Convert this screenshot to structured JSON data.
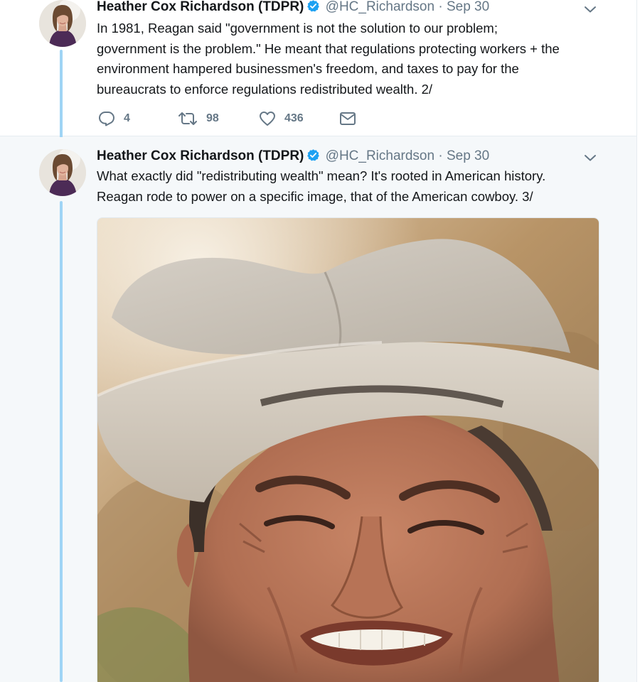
{
  "tweets": [
    {
      "author_name": "Heather Cox Richardson (TDPR)",
      "handle": "@HC_Richardson",
      "separator": "·",
      "date": "Sep 30",
      "text_lines": [
        "In 1981, Reagan said \"government is not the solution to our problem;",
        "government is the problem.\" He meant that regulations protecting workers + the",
        "environment hampered businessmen's freedom, and taxes to pay for the",
        "bureaucrats to enforce regulations redistributed wealth. 2/"
      ],
      "actions": {
        "reply_count": "4",
        "retweet_count": "98",
        "like_count": "436"
      }
    },
    {
      "author_name": "Heather Cox Richardson (TDPR)",
      "handle": "@HC_Richardson",
      "separator": "·",
      "date": "Sep 30",
      "text_lines": [
        "What exactly did \"redistributing wealth\" mean? It's rooted in American history.",
        "Reagan rode to power on a specific image, that of the American cowboy. 3/"
      ]
    }
  ],
  "icons": {
    "verified": "verified-badge-icon",
    "more": "chevron-down-icon",
    "reply": "reply-icon",
    "retweet": "retweet-icon",
    "like": "heart-icon",
    "dm": "envelope-icon"
  },
  "colors": {
    "verified_blue": "#1da1f2",
    "thread_line": "#9fd4f5",
    "secondary_text": "#657786",
    "primary_text": "#14171a",
    "tweet_background": "#ffffff",
    "thread_background": "#f5f8fa"
  }
}
